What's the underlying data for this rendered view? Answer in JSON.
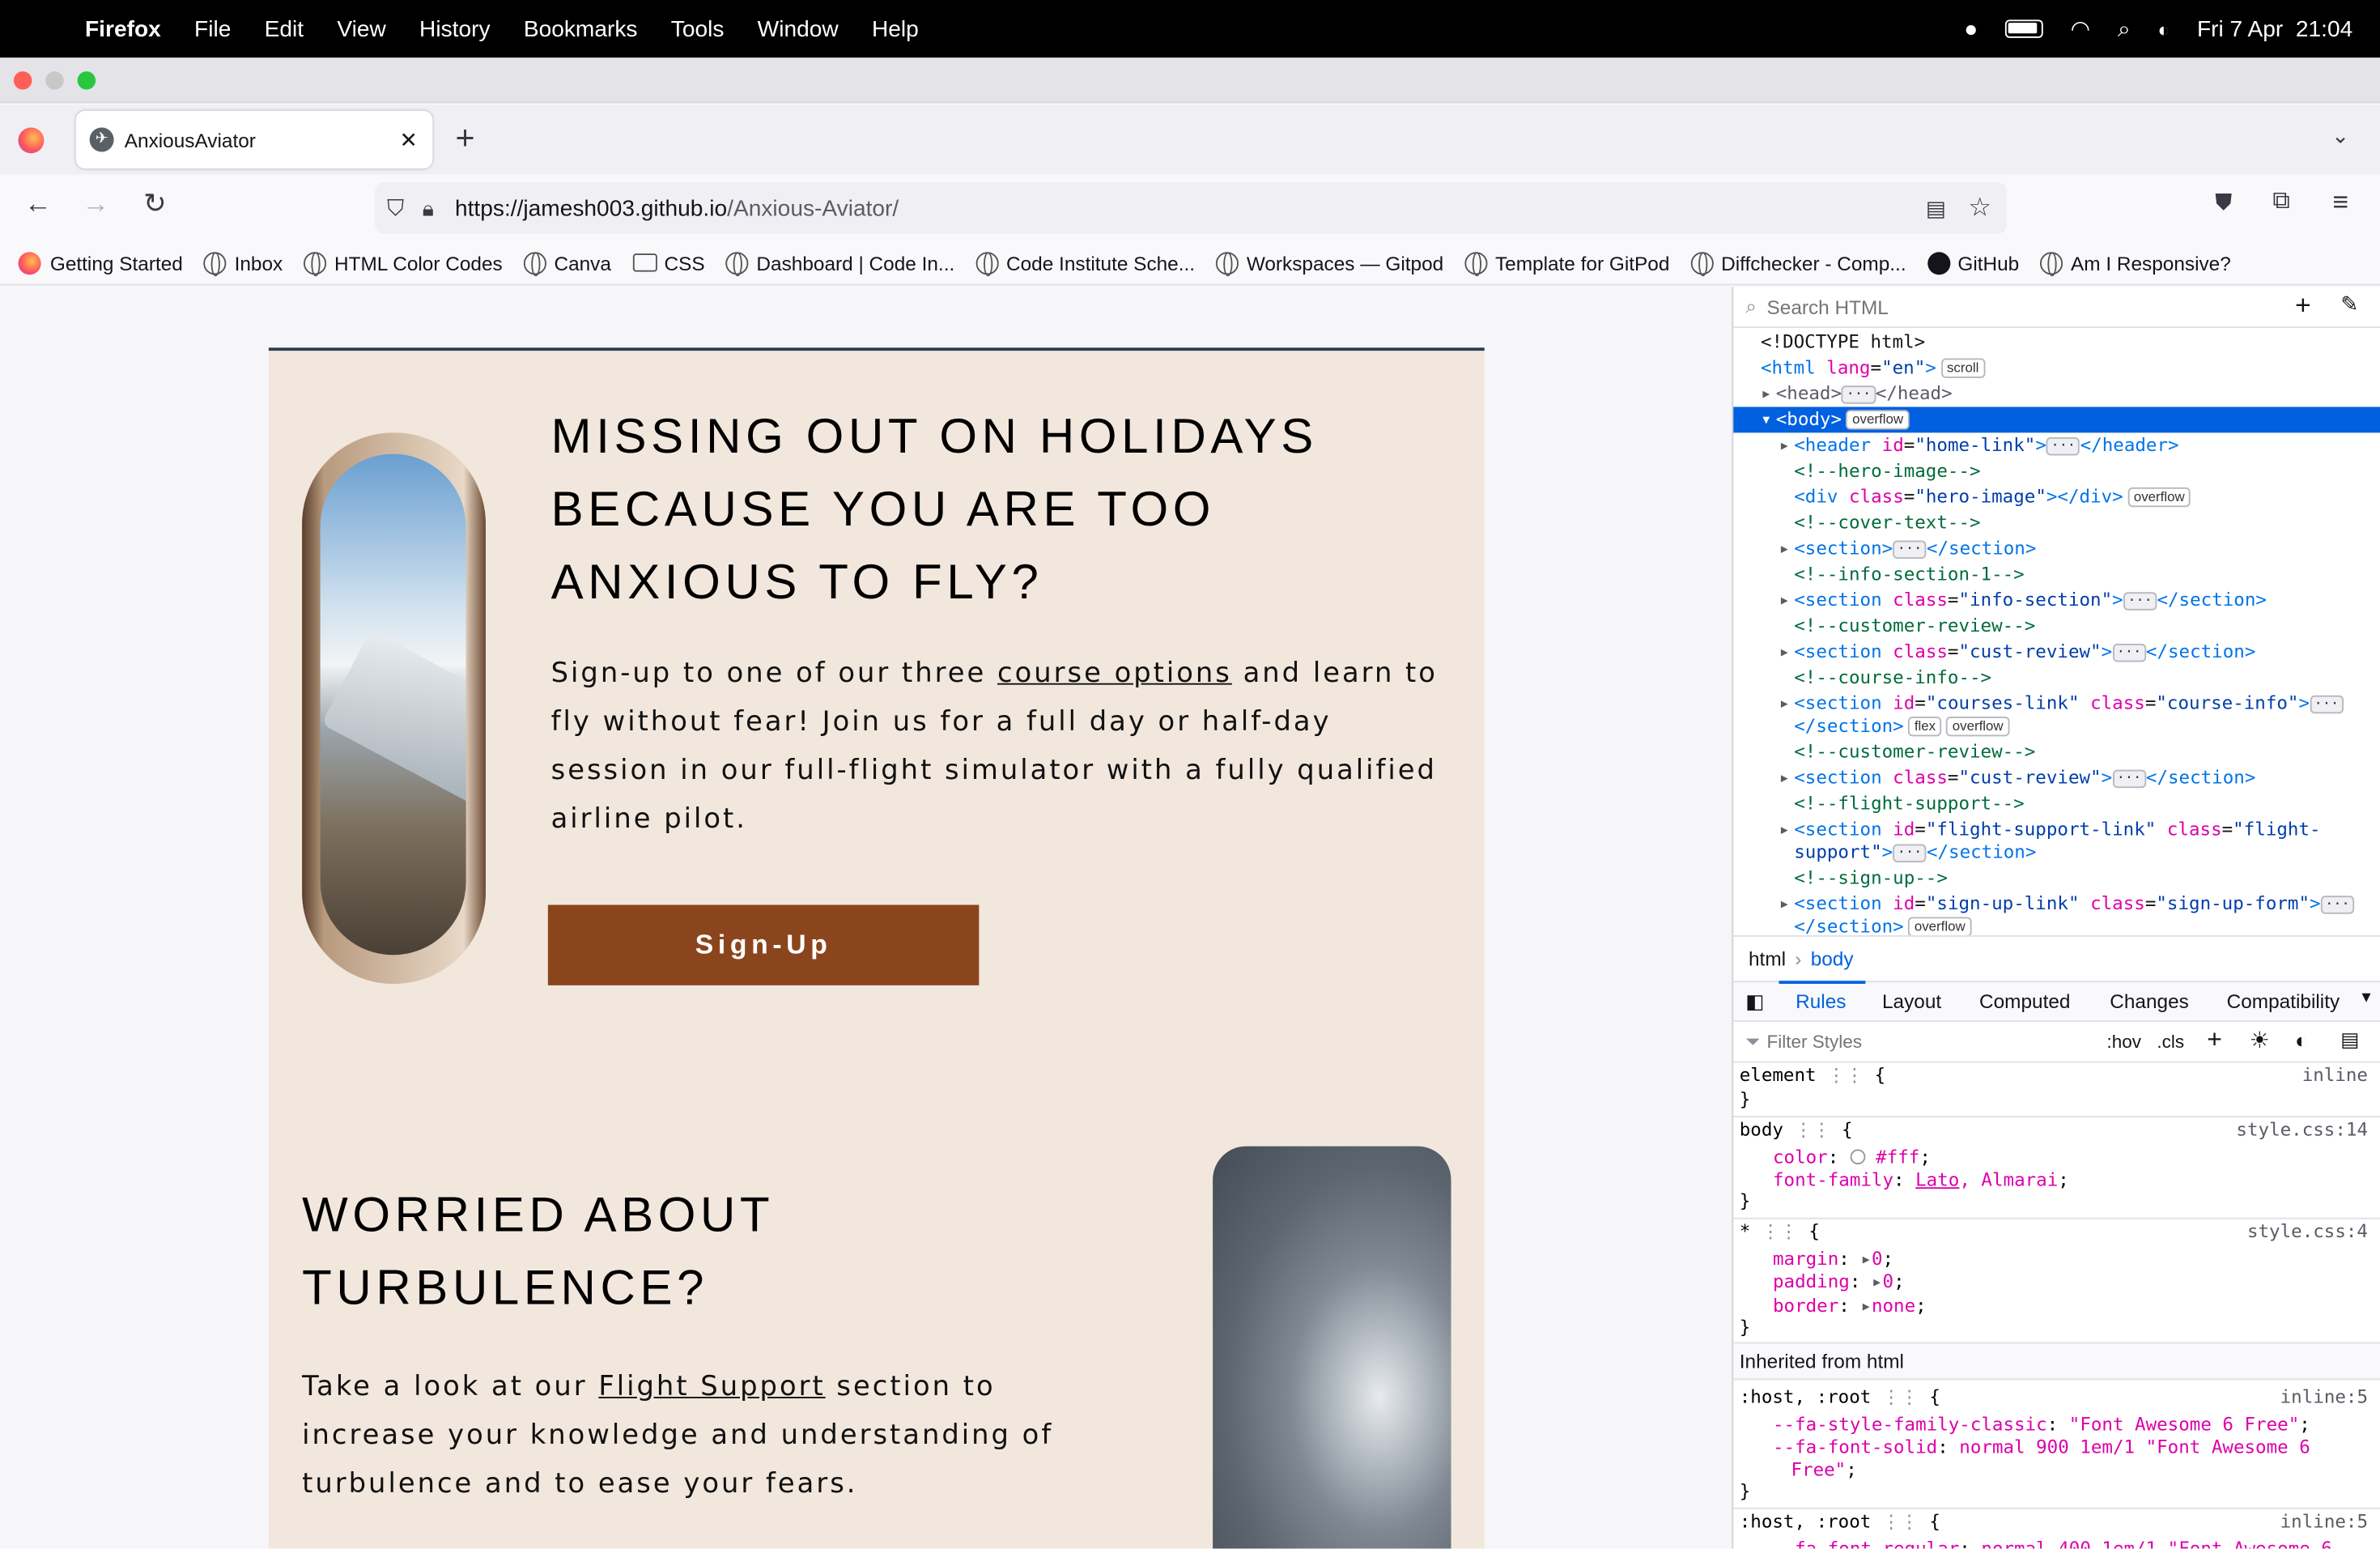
{
  "menubar": {
    "app": "Firefox",
    "items": [
      "File",
      "Edit",
      "View",
      "History",
      "Bookmarks",
      "Tools",
      "Window",
      "Help"
    ],
    "datetime": "Fri 7 Apr  21:04"
  },
  "tab": {
    "title": "AnxiousAviator"
  },
  "url": {
    "host": "https://jamesh003.github.io",
    "path": "/Anxious-Aviator/"
  },
  "bookmarks": [
    "Getting Started",
    "Inbox",
    "HTML Color Codes",
    "Canva",
    "CSS",
    "Dashboard | Code In...",
    "Code Institute Sche...",
    "Workspaces — Gitpod",
    "Template for GitPod",
    "Diffchecker - Comp...",
    "GitHub",
    "Am I Responsive?"
  ],
  "page": {
    "section1": {
      "heading": "MISSING OUT ON HOLIDAYS BECAUSE YOU ARE TOO ANXIOUS TO FLY?",
      "p_before": "Sign-up to one of our three ",
      "p_link": "course options",
      "p_after": " and learn to fly without fear! Join us for a full day or half-day session in our full-flight simulator with a fully qualified airline pilot.",
      "button": "Sign-Up"
    },
    "section2": {
      "heading": "WORRIED ABOUT TURBULENCE?",
      "p_before": "Take a look at our ",
      "p_link": "Flight Support",
      "p_after": " section to increase your knowledge and understanding of turbulence and to ease your fears."
    }
  },
  "devtools": {
    "search_placeholder": "Search HTML",
    "breadcrumb": [
      "html",
      "body"
    ],
    "tabs": [
      "Rules",
      "Layout",
      "Computed",
      "Changes",
      "Compatibility"
    ],
    "filter_placeholder": "Filter Styles",
    "hov": ":hov",
    "cls": ".cls",
    "inherited": "Inherited from html",
    "src_inline": "inline",
    "src_style14": "style.css:14",
    "src_style4": "style.css:4",
    "src_inline5": "inline:5",
    "badge_scroll": "scroll",
    "badge_overflow": "overflow",
    "badge_flex": "flex"
  }
}
